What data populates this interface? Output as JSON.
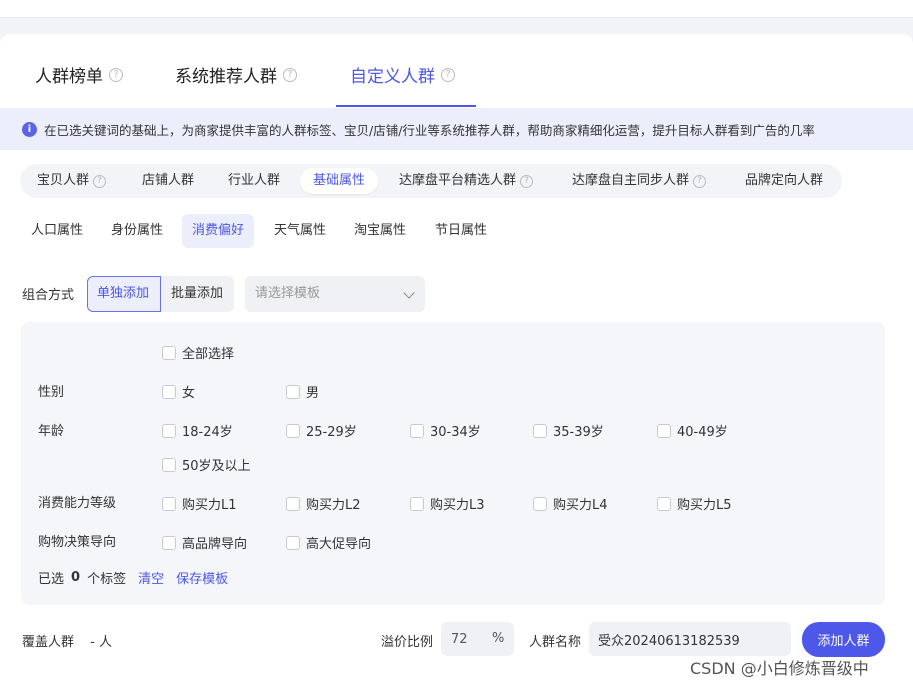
{
  "tabs": [
    {
      "label": "人群榜单",
      "help": "?"
    },
    {
      "label": "系统推荐人群",
      "help": "?"
    },
    {
      "label": "自定义人群",
      "help": "?"
    }
  ],
  "notice": {
    "icon": "info-icon",
    "text": "在已选关键词的基础上，为商家提供丰富的人群标签、宝贝/店铺/行业等系统推荐人群，帮助商家精细化运营，提升目标人群看到广告的几率"
  },
  "categories": [
    {
      "label": "宝贝人群",
      "help": "?"
    },
    {
      "label": "店铺人群"
    },
    {
      "label": "行业人群"
    },
    {
      "label": "基础属性"
    },
    {
      "label": "达摩盘平台精选人群",
      "help": "?"
    },
    {
      "label": "达摩盘自主同步人群",
      "help": "?"
    },
    {
      "label": "品牌定向人群"
    }
  ],
  "subtabs": [
    "人口属性",
    "身份属性",
    "消费偏好",
    "天气属性",
    "淘宝属性",
    "节日属性"
  ],
  "combo": {
    "label": "组合方式",
    "single": "单独添加",
    "batch": "批量添加",
    "template_placeholder": "请选择模板"
  },
  "panel": {
    "select_all": "全部选择",
    "gender": {
      "label": "性别",
      "options": [
        "女",
        "男"
      ]
    },
    "age": {
      "label": "年龄",
      "options": [
        "18-24岁",
        "25-29岁",
        "30-34岁",
        "35-39岁",
        "40-49岁",
        "50岁及以上"
      ]
    },
    "power": {
      "label": "消费能力等级",
      "options": [
        "购买力L1",
        "购买力L2",
        "购买力L3",
        "购买力L4",
        "购买力L5"
      ]
    },
    "decision": {
      "label": "购物决策导向",
      "options": [
        "高品牌导向",
        "高大促导向"
      ]
    },
    "selected": {
      "prefix": "已选",
      "count": "0",
      "suffix": "个标签",
      "clear": "清空",
      "save": "保存模板"
    }
  },
  "footer": {
    "cover_label": "覆盖人群",
    "cover_value": "- 人",
    "ratio_label": "溢价比例",
    "ratio_value": "72",
    "ratio_unit": "%",
    "name_label": "人群名称",
    "name_value": "受众20240613182539",
    "add_button": "添加人群"
  },
  "watermark": "CSDN @小白修炼晋级中",
  "colors": {
    "accent": "#4d57e8",
    "notice_bg": "#edeefc",
    "panel_bg": "#f5f6f9"
  }
}
